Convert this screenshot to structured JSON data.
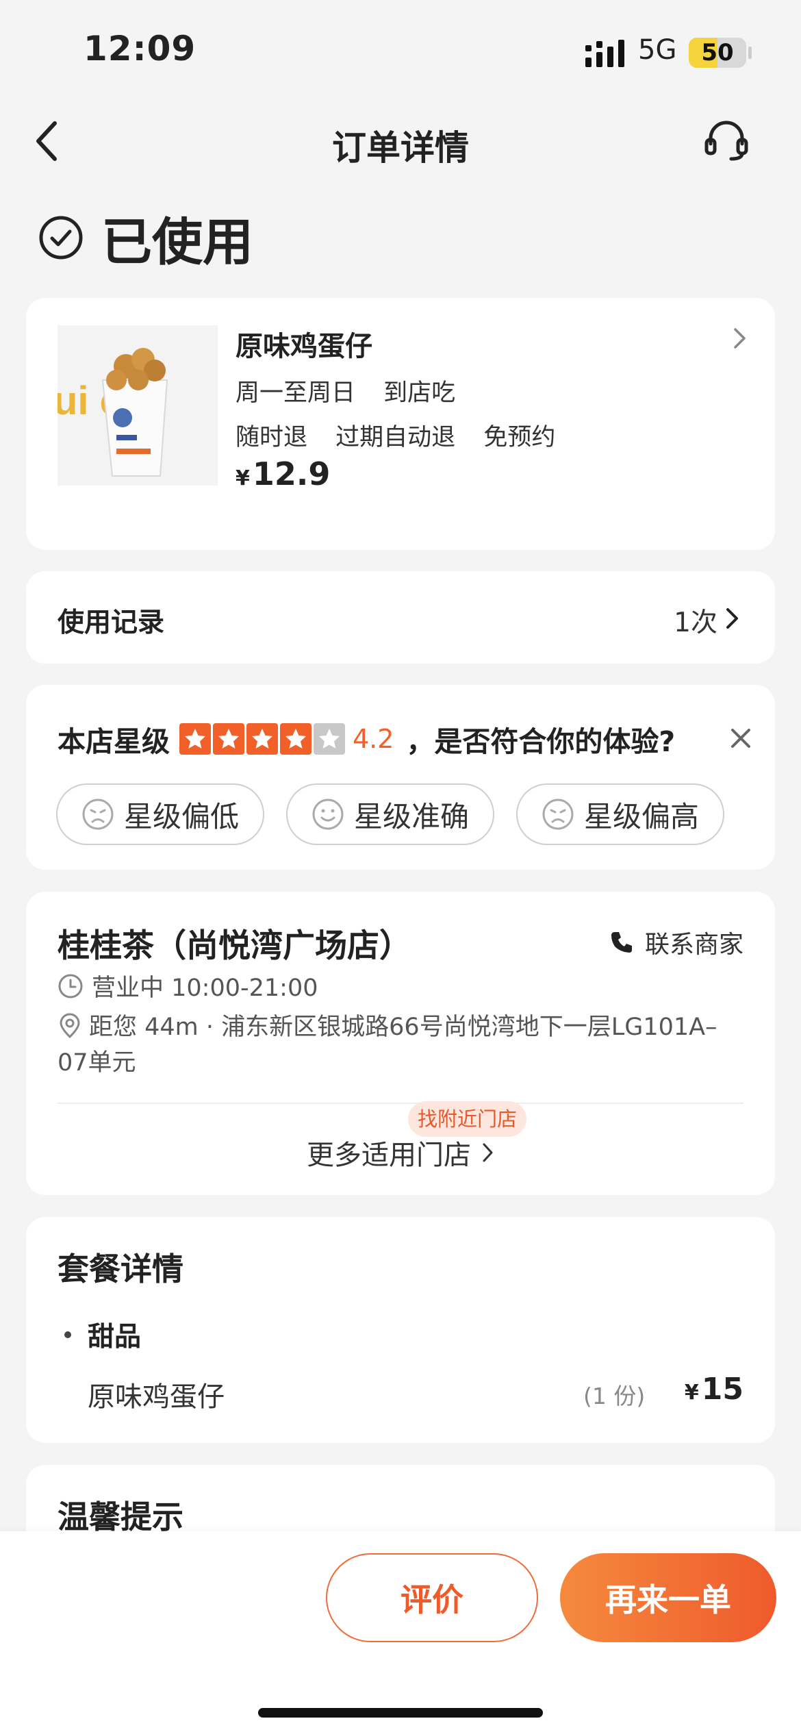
{
  "status_bar": {
    "time": "12:09",
    "network": "5G",
    "battery_percent": 50,
    "battery_label": "50"
  },
  "nav": {
    "title": "订单详情",
    "icons": {
      "back": "chevron-left-icon",
      "service": "headset-icon"
    }
  },
  "order_status": {
    "label": "已使用",
    "icon": "check-circle-icon"
  },
  "product": {
    "name": "原味鸡蛋仔",
    "tags_line1": [
      "周一至周日",
      "到店吃"
    ],
    "tags_line2": [
      "随时退",
      "过期自动退",
      "免预约"
    ],
    "currency": "¥",
    "price": "12.9",
    "image_text": "ui ch"
  },
  "usage": {
    "label": "使用记录",
    "count": "1次"
  },
  "rating": {
    "label": "本店星级",
    "score": "4.2",
    "score_value": 4.2,
    "max_stars": 5,
    "question": "，是否符合你的体验?",
    "options": [
      "星级偏低",
      "星级准确",
      "星级偏高"
    ],
    "colors": {
      "star_active": "#f2602a",
      "star_inactive": "#c8c8c8"
    }
  },
  "store": {
    "name": "桂桂茶（尚悦湾广场店）",
    "contact_label": "联系商家",
    "hours": "营业中 10:00-21:00",
    "distance": "距您 44m",
    "address": "浦东新区银城路66号尚悦湾地下一层LG101A–07单元",
    "nearby_badge": "找附近门店",
    "more_stores_label": "更多适用门店"
  },
  "package": {
    "title": "套餐详情",
    "category": "甜品",
    "item_name": "原味鸡蛋仔",
    "item_qty": "(1 份)",
    "currency": "¥",
    "item_price": "15"
  },
  "tips": {
    "title": "温馨提示"
  },
  "actions": {
    "review_label": "评价",
    "reorder_label": "再来一单"
  },
  "colors": {
    "accent": "#ef5a2c",
    "background": "#f4f4f5"
  }
}
